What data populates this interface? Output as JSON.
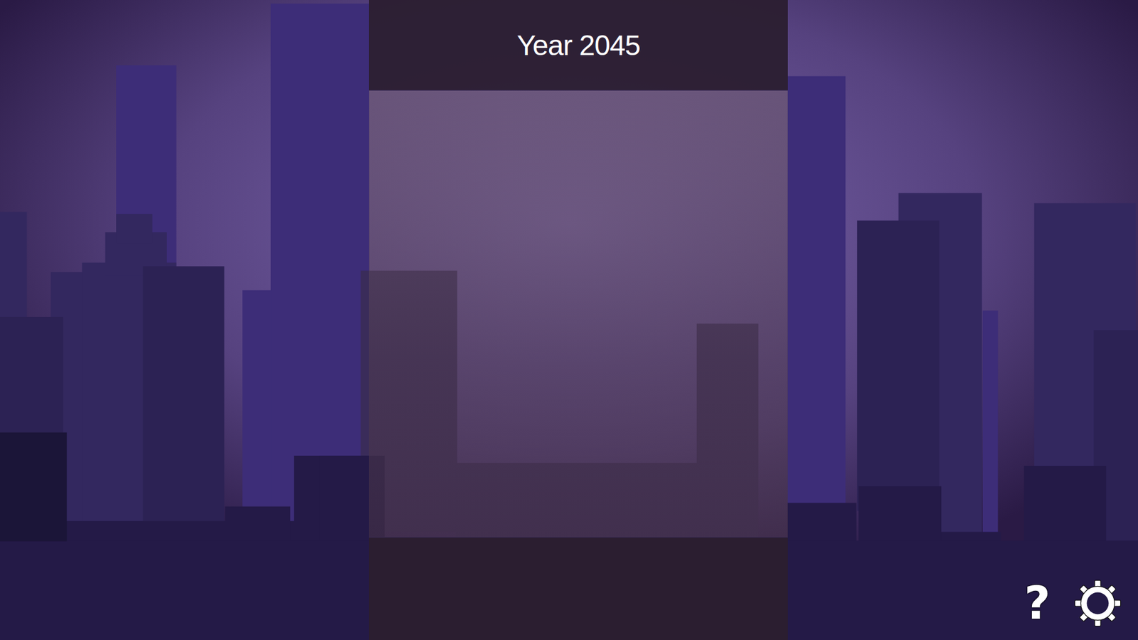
{
  "panel": {
    "title": "Year 2045"
  },
  "controls": {
    "help": "?"
  }
}
